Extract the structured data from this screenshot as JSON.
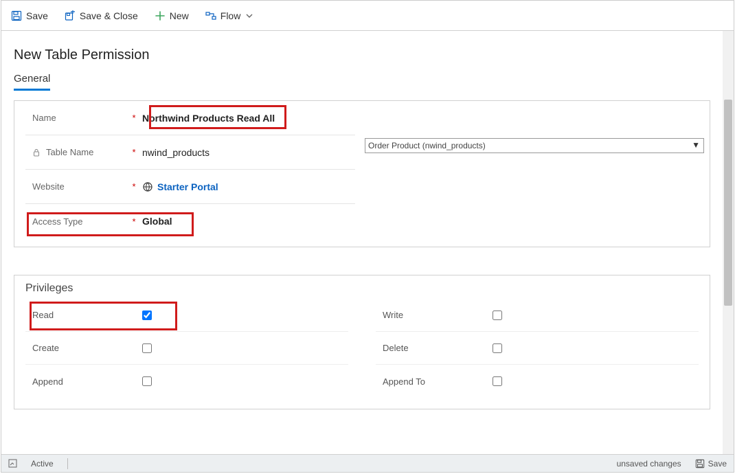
{
  "toolbar": {
    "save": "Save",
    "save_close": "Save & Close",
    "new": "New",
    "flow": "Flow"
  },
  "page": {
    "title": "New Table Permission",
    "tab_general": "General"
  },
  "general": {
    "labels": {
      "name": "Name",
      "table_name": "Table Name",
      "website": "Website",
      "access_type": "Access Type"
    },
    "name_value": "Northwind Products Read All",
    "table_name_value": "nwind_products",
    "website_value": "Starter Portal",
    "access_type_value": "Global",
    "table_select_display": "Order Product (nwind_products)"
  },
  "privileges": {
    "section_title": "Privileges",
    "labels": {
      "read": "Read",
      "write": "Write",
      "create": "Create",
      "delete": "Delete",
      "append": "Append",
      "append_to": "Append To"
    },
    "values": {
      "read": true,
      "write": false,
      "create": false,
      "delete": false,
      "append": false,
      "append_to": false
    }
  },
  "footer": {
    "status": "Active",
    "unsaved": "unsaved changes",
    "save": "Save"
  }
}
